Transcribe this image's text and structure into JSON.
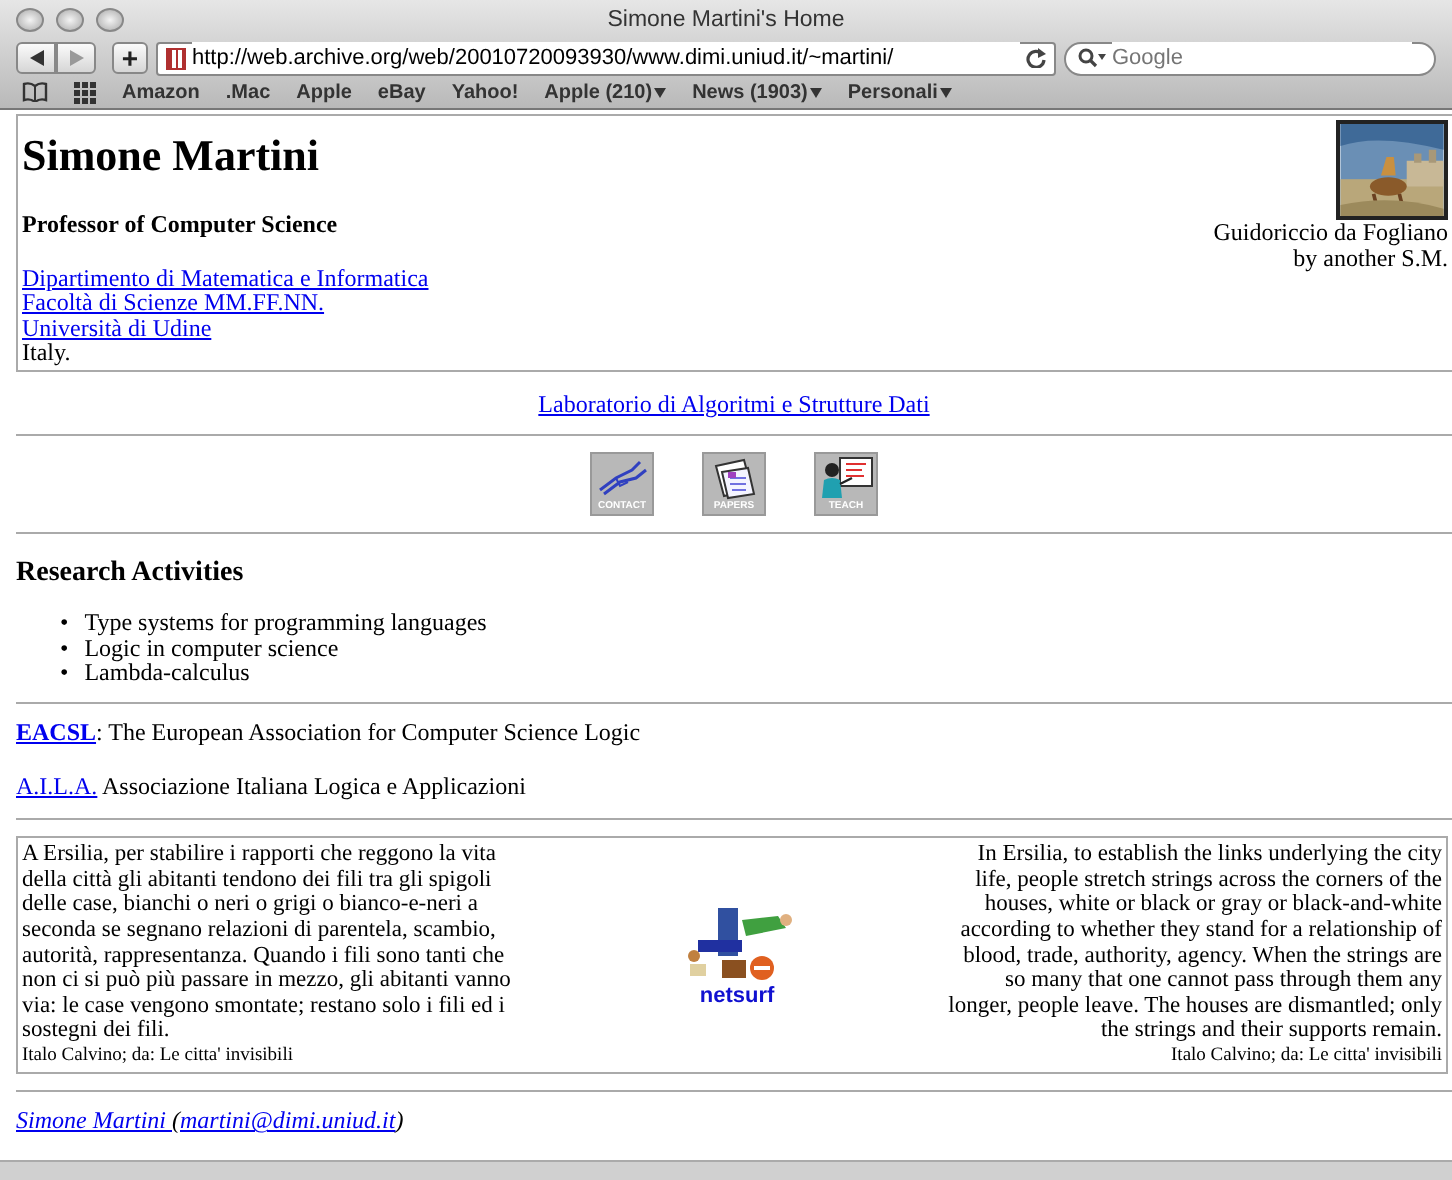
{
  "browser": {
    "title": "Simone Martini's Home",
    "add_button": "+",
    "url": "http://web.archive.org/web/20010720093930/www.dimi.uniud.it/~martini/",
    "search": {
      "placeholder": "Google"
    },
    "bookmarks": [
      {
        "label": "Amazon",
        "menu": false
      },
      {
        "label": ".Mac",
        "menu": false
      },
      {
        "label": "Apple",
        "menu": false
      },
      {
        "label": "eBay",
        "menu": false
      },
      {
        "label": "Yahoo!",
        "menu": false
      },
      {
        "label": "Apple (210)",
        "menu": true
      },
      {
        "label": "News (1903)",
        "menu": true
      },
      {
        "label": "Personali",
        "menu": true
      }
    ]
  },
  "header": {
    "name": "Simone Martini",
    "subtitle": "Professor of Computer Science",
    "affiliations": [
      {
        "text": "Dipartimento di Matematica e Informatica",
        "link": true
      },
      {
        "text": "Facoltà di Scienze MM.FF.NN.",
        "link": true
      },
      {
        "text": "Università di Udine",
        "link": true
      },
      {
        "text": "Italy.",
        "link": false
      }
    ],
    "caption": [
      "Guidoriccio da Fogliano",
      "by another S.M."
    ]
  },
  "lab_link": "Laboratorio di Algoritmi e Strutture Dati",
  "nav_icons": [
    {
      "kind": "contact",
      "label": "CONTACT"
    },
    {
      "kind": "papers",
      "label": "PAPERS"
    },
    {
      "kind": "teach",
      "label": "TEACH"
    }
  ],
  "research": {
    "heading": "Research Activities",
    "marker": "•",
    "items": [
      "Type systems for programming languages",
      "Logic in computer science",
      "Lambda-calculus"
    ]
  },
  "associations": [
    {
      "abbr": "EACSL",
      "bold": true,
      "text": ": The European Association for Computer Science Logic"
    },
    {
      "abbr": "A.I.L.A.",
      "bold": false,
      "text": " Associazione Italiana Logica e Applicazioni"
    }
  ],
  "quote": {
    "italian": "A Ersilia, per stabilire i rapporti che reggono la vita della città gli abitanti tendono dei fili tra gli spigoli delle case, bianchi o neri o grigi o bianco-e-neri a seconda se segnano relazioni di parentela, scambio, autorità, rappresentanza. Quando i fili sono tanti che non ci si può più passare in mezzo, gli abitanti vanno via: le case vengono smontate; restano solo i fili ed i sostegni dei fili.",
    "italian_source": "Italo Calvino; da: Le citta' invisibili",
    "logo_text": "netsurf",
    "english": "In Ersilia, to establish the links underlying the city life, people stretch strings across the corners of the houses, white or black or gray or black-and-white according to whether they stand for a relationship of blood, trade, authority, agency. When the strings are so many that one cannot pass through them any longer, people leave. The houses are dismantled; only the strings and their supports remain.",
    "english_source": "Italo Calvino; da: Le citta' invisibili"
  },
  "footer": {
    "name": "Simone Martini ",
    "email": "martini@dimi.uniud.it",
    "open": "(",
    "close": ")"
  }
}
